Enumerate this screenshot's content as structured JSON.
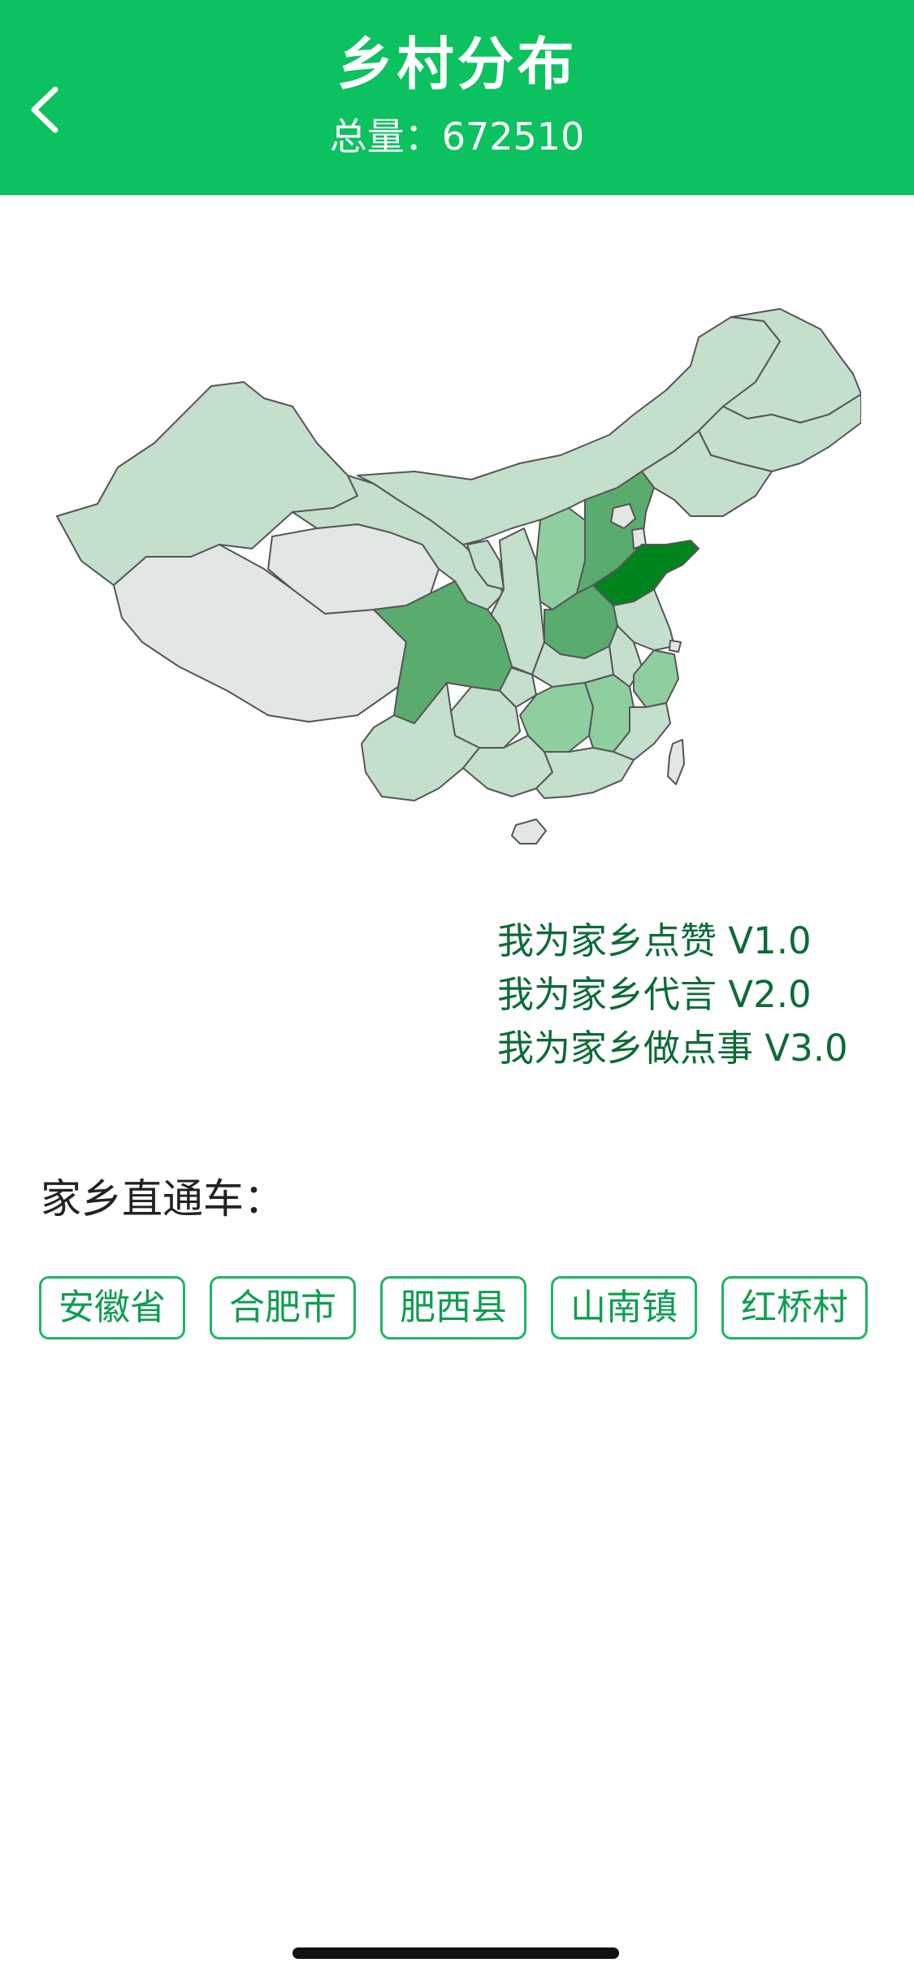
{
  "header": {
    "title": "乡村分布",
    "total_label": "总量：672510"
  },
  "colors": {
    "header_bg": "#0cc15f",
    "chip_border": "#1db763",
    "chip_text": "#0f9d4f",
    "slogan_text": "#0d6b36",
    "map_lightest": "#e2e7e3",
    "map_light": "#c4dfcc",
    "map_mid": "#8fcf9f",
    "map_dark": "#5aac6e",
    "map_darkest": "#00841e"
  },
  "icons": {
    "back": "chevron-left-icon"
  },
  "slogans": [
    "我为家乡点赞 V1.0",
    "我为家乡代言 V2.0",
    "我为家乡做点事 V3.0"
  ],
  "section": {
    "title": "家乡直通车："
  },
  "chips": [
    "安徽省",
    "合肥市",
    "肥西县",
    "山南镇",
    "红桥村"
  ]
}
